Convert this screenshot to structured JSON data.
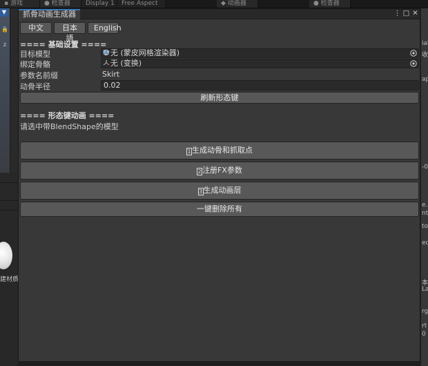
{
  "background": {
    "tabs": [
      "游戏",
      "检查器",
      "Display 1",
      "Free Aspect",
      "动画器",
      "检查器"
    ],
    "left_label": "建材质",
    "right_fragments": [
      "ial",
      "收网",
      "ap",
      "-0",
      "e.",
      "nts",
      "to",
      "edit",
      "本",
      "La",
      "rg",
      "rt",
      "0"
    ]
  },
  "window": {
    "title": "抓骨动画生成器",
    "controls": {
      "menu": "⋮",
      "maximize": "□",
      "close": "✕"
    }
  },
  "languages": [
    "中文",
    "日本語",
    "English"
  ],
  "basic_settings": {
    "header": "==== 基础设置 ====",
    "target_model": {
      "label": "目标模型",
      "value": "无 (蒙皮网格渲染器)"
    },
    "bind_bone": {
      "label": "绑定骨骼",
      "value": "无 (变换)"
    },
    "param_prefix": {
      "label": "参数名前缀",
      "value": "Skirt"
    },
    "bone_radius": {
      "label": "动骨半径",
      "value": "0.02"
    },
    "refresh_button": "刷新形态键"
  },
  "shapekey_section": {
    "header": "==== 形态键动画 ====",
    "hint": "请选中带BlendShape的模型"
  },
  "actions": [
    {
      "index": "1",
      "label": "生成动骨和抓取点"
    },
    {
      "index": "2",
      "label": "注册FX参数"
    },
    {
      "index": "3",
      "label": "生成动画层"
    },
    {
      "index": "",
      "label": "一键删除所有"
    }
  ],
  "colors": {
    "accent": "#3a79bb",
    "panel": "#383838",
    "button": "#585858",
    "field": "#2a2a2a"
  }
}
